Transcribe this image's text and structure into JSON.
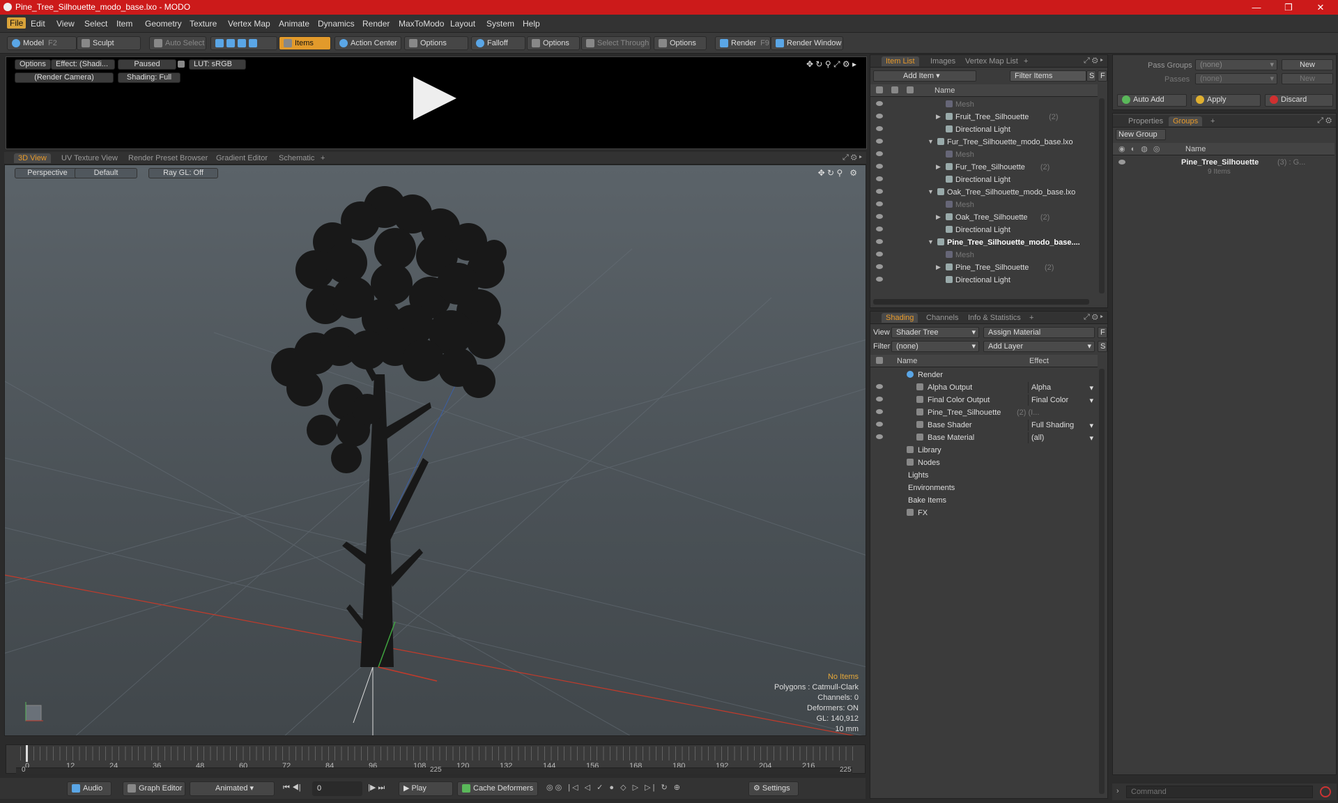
{
  "window": {
    "title": "Pine_Tree_Silhouette_modo_base.lxo - MODO",
    "min": "—",
    "max": "❐",
    "close": "✕"
  },
  "menu": [
    "File",
    "Edit",
    "View",
    "Select",
    "Item",
    "Geometry",
    "Texture",
    "Vertex Map",
    "Animate",
    "Dynamics",
    "Render",
    "MaxToModo",
    "Layout",
    "System",
    "Help"
  ],
  "toolbar": {
    "model": "Model",
    "model_key": "F2",
    "sculpt": "Sculpt",
    "auto_select": "Auto Select",
    "items": "Items",
    "action_center": "Action Center",
    "options1": "Options",
    "falloff": "Falloff",
    "options2": "Options",
    "select_through": "Select Through",
    "options3": "Options",
    "render": "Render",
    "render_key": "F9",
    "render_window": "Render Window"
  },
  "preview": {
    "options": "Options",
    "effect": "Effect: (Shadi...",
    "paused": "Paused",
    "lut": "LUT: sRGB",
    "camera": "(Render Camera)",
    "shading": "Shading: Full"
  },
  "view_tabs": [
    "3D View",
    "UV Texture View",
    "Render Preset Browser",
    "Gradient Editor",
    "Schematic"
  ],
  "viewport": {
    "perspective": "Perspective",
    "default": "Default",
    "raygl": "Ray GL: Off",
    "info": [
      "No Items",
      "Polygons : Catmull-Clark",
      "Channels: 0",
      "Deformers: ON",
      "GL: 140,912",
      "10 mm"
    ]
  },
  "timeline": {
    "ticks": [
      "0",
      "12",
      "24",
      "36",
      "48",
      "60",
      "72",
      "84",
      "96",
      "108",
      "120",
      "132",
      "144",
      "156",
      "168",
      "180",
      "192",
      "204",
      "216"
    ],
    "start": "0",
    "mid": "225",
    "end": "225"
  },
  "bottom": {
    "audio": "Audio",
    "graph_editor": "Graph Editor",
    "animated": "Animated",
    "frame": "0",
    "play": "Play",
    "cache": "Cache Deformers",
    "settings": "Settings"
  },
  "item_list": {
    "tabs": [
      "Item List",
      "Images",
      "Vertex Map List"
    ],
    "add_item": "Add Item",
    "filter": "Filter Items",
    "s": "S",
    "f": "F",
    "col_name": "Name",
    "rows": [
      {
        "label": "Mesh",
        "count": "",
        "indent": 2,
        "dim": true,
        "bold": false,
        "exp": ""
      },
      {
        "label": "Fruit_Tree_Silhouette",
        "count": "(2)",
        "indent": 2,
        "dim": false,
        "bold": false,
        "exp": "▶"
      },
      {
        "label": "Directional Light",
        "count": "",
        "indent": 2,
        "dim": false,
        "bold": false,
        "exp": ""
      },
      {
        "label": "Fur_Tree_Silhouette_modo_base.lxo",
        "count": "",
        "indent": 1,
        "dim": false,
        "bold": false,
        "exp": "▼"
      },
      {
        "label": "Mesh",
        "count": "",
        "indent": 2,
        "dim": true,
        "bold": false,
        "exp": ""
      },
      {
        "label": "Fur_Tree_Silhouette",
        "count": "(2)",
        "indent": 2,
        "dim": false,
        "bold": false,
        "exp": "▶"
      },
      {
        "label": "Directional Light",
        "count": "",
        "indent": 2,
        "dim": false,
        "bold": false,
        "exp": ""
      },
      {
        "label": "Oak_Tree_Silhouette_modo_base.lxo",
        "count": "",
        "indent": 1,
        "dim": false,
        "bold": false,
        "exp": "▼"
      },
      {
        "label": "Mesh",
        "count": "",
        "indent": 2,
        "dim": true,
        "bold": false,
        "exp": ""
      },
      {
        "label": "Oak_Tree_Silhouette",
        "count": "(2)",
        "indent": 2,
        "dim": false,
        "bold": false,
        "exp": "▶"
      },
      {
        "label": "Directional Light",
        "count": "",
        "indent": 2,
        "dim": false,
        "bold": false,
        "exp": ""
      },
      {
        "label": "Pine_Tree_Silhouette_modo_base....",
        "count": "",
        "indent": 1,
        "dim": false,
        "bold": true,
        "exp": "▼"
      },
      {
        "label": "Mesh",
        "count": "",
        "indent": 2,
        "dim": true,
        "bold": false,
        "exp": ""
      },
      {
        "label": "Pine_Tree_Silhouette",
        "count": "(2)",
        "indent": 2,
        "dim": false,
        "bold": false,
        "exp": "▶"
      },
      {
        "label": "Directional Light",
        "count": "",
        "indent": 2,
        "dim": false,
        "bold": false,
        "exp": ""
      }
    ]
  },
  "shading": {
    "tabs": [
      "Shading",
      "Channels",
      "Info & Statistics"
    ],
    "view_label": "View",
    "view_value": "Shader Tree",
    "assign": "Assign Material",
    "f": "F",
    "filter_label": "Filter",
    "filter_value": "(none)",
    "add_layer": "Add Layer",
    "s": "S",
    "col_name": "Name",
    "col_effect": "Effect",
    "rows": [
      {
        "label": "Render",
        "effect": "",
        "indent": 0,
        "eye": false
      },
      {
        "label": "Alpha Output",
        "effect": "Alpha",
        "indent": 1,
        "eye": true
      },
      {
        "label": "Final Color Output",
        "effect": "Final Color",
        "indent": 1,
        "eye": true
      },
      {
        "label": "Pine_Tree_Silhouette",
        "effect": "",
        "indent": 1,
        "eye": true,
        "count": "(2) (I..."
      },
      {
        "label": "Base Shader",
        "effect": "Full Shading",
        "indent": 1,
        "eye": true
      },
      {
        "label": "Base Material",
        "effect": "(all)",
        "indent": 1,
        "eye": true
      },
      {
        "label": "Library",
        "effect": "",
        "indent": 0,
        "eye": false
      },
      {
        "label": "Nodes",
        "effect": "",
        "indent": 0,
        "eye": false
      },
      {
        "label": "Lights",
        "effect": "",
        "indent": -1,
        "eye": false
      },
      {
        "label": "Environments",
        "effect": "",
        "indent": -1,
        "eye": false
      },
      {
        "label": "Bake Items",
        "effect": "",
        "indent": -1,
        "eye": false
      },
      {
        "label": "FX",
        "effect": "",
        "indent": 0,
        "eye": false
      }
    ]
  },
  "passes": {
    "pass_groups": "Pass Groups",
    "pass_value": "(none)",
    "new": "New",
    "passes": "Passes",
    "passes_value": "(none)",
    "new2": "New",
    "auto_add": "Auto Add",
    "apply": "Apply",
    "discard": "Discard"
  },
  "groups": {
    "tabs": [
      "Properties",
      "Groups"
    ],
    "new_group": "New Group",
    "col_name": "Name",
    "group_name": "Pine_Tree_Silhouette",
    "group_count": "(3) : G...",
    "group_items": "9 Items"
  },
  "command": {
    "placeholder": "Command"
  }
}
